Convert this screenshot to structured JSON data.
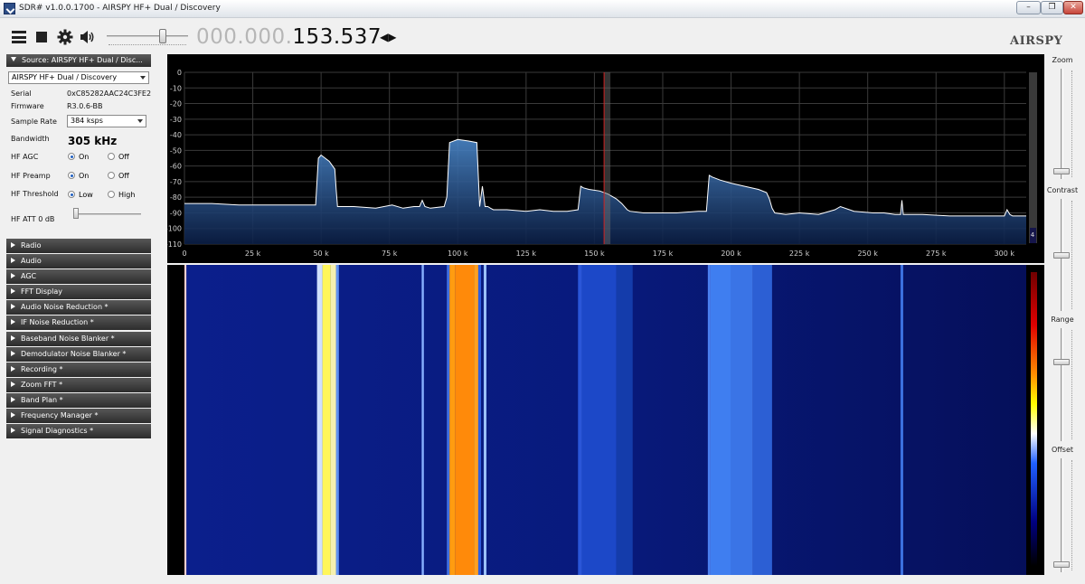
{
  "window": {
    "title": "SDR# v1.0.0.1700 - AIRSPY HF+ Dual / Discovery",
    "controls": {
      "minimize": "–",
      "maximize": "❐",
      "close": "✕"
    }
  },
  "toolbar": {
    "frequency_dim": "000.000.",
    "frequency_bright": "153.537",
    "tune_arrows": "◀▶",
    "logo": "AIRSPY",
    "icons": [
      "menu-icon",
      "stop-icon",
      "gear-icon",
      "speaker-icon"
    ]
  },
  "source": {
    "header": "Source: AIRSPY HF+ Dual / Disc...",
    "device": "AIRSPY HF+ Dual / Discovery",
    "serial_label": "Serial",
    "serial": "0xC85282AAC24C3FE2",
    "firmware_label": "Firmware",
    "firmware": "R3.0.6-BB",
    "sample_rate_label": "Sample Rate",
    "sample_rate": "384 ksps",
    "bandwidth_label": "Bandwidth",
    "bandwidth": "305 kHz",
    "hf_agc_label": "HF AGC",
    "hf_preamp_label": "HF Preamp",
    "hf_threshold_label": "HF Threshold",
    "on": "On",
    "off": "Off",
    "low": "Low",
    "high": "High",
    "hf_att_label": "HF ATT 0 dB",
    "hf_agc": "On",
    "hf_preamp": "On",
    "hf_threshold": "Low"
  },
  "plugins": [
    "Radio",
    "Audio",
    "AGC",
    "FFT Display",
    "Audio Noise Reduction *",
    "IF Noise Reduction *",
    "Baseband Noise Blanker *",
    "Demodulator Noise Blanker *",
    "Recording *",
    "Zoom FFT *",
    "Band Plan *",
    "Frequency Manager *",
    "Signal Diagnostics *"
  ],
  "right_panel": {
    "zoom": "Zoom",
    "contrast": "Contrast",
    "range": "Range",
    "offset": "Offset",
    "scroll_value": "4"
  },
  "colors": {
    "plot_bg": "#000000",
    "trace": "#ffffff",
    "fill": "#2a5b9a",
    "grid": "#3a3a3a",
    "cursor": "#d02020",
    "waterfall_bg": "#06126b"
  },
  "chart_data": {
    "type": "area",
    "title": "",
    "xlabel": "",
    "ylabel": "",
    "x_ticks": [
      "0",
      "25 k",
      "50 k",
      "75 k",
      "100 k",
      "125 k",
      "150 k",
      "175 k",
      "200 k",
      "225 k",
      "250 k",
      "275 k",
      "300 k"
    ],
    "y_ticks": [
      "0",
      "-10",
      "-20",
      "-30",
      "-40",
      "-50",
      "-60",
      "-70",
      "-80",
      "-90",
      "-100",
      "-110"
    ],
    "xlim": [
      0,
      308000
    ],
    "ylim": [
      -110,
      0
    ],
    "grid": true,
    "cursor_x": 153537,
    "series": [
      {
        "x": [
          0,
          10000,
          20000,
          30000,
          45000,
          48000,
          49000,
          50000,
          53000,
          55000,
          55500,
          56000,
          58000,
          62000,
          70000,
          76000,
          80000,
          84000,
          86000,
          87000,
          88000,
          90000,
          95000,
          96000,
          97000,
          100000,
          104000,
          107000,
          108000,
          109000,
          110000,
          111000,
          112000,
          113000,
          118000,
          125000,
          130000,
          135000,
          140000,
          144000,
          145000,
          146000,
          148000,
          152000,
          155000,
          158000,
          160000,
          162000,
          163000,
          168000,
          175000,
          180000,
          188000,
          191000,
          192000,
          193000,
          196000,
          200000,
          205000,
          210000,
          213000,
          214000,
          215000,
          216000,
          220000,
          225000,
          232000,
          238000,
          240000,
          245000,
          252000,
          256000,
          260000,
          262000,
          262500,
          263000,
          265000,
          270000,
          280000,
          290000,
          300000,
          301000,
          302000,
          303000,
          308000
        ],
        "y": [
          -84,
          -84,
          -85,
          -85,
          -85,
          -85,
          -55,
          -53,
          -57,
          -62,
          -75,
          -86,
          -86,
          -86,
          -87,
          -85,
          -87,
          -86,
          -86,
          -82,
          -86,
          -87,
          -86,
          -80,
          -45,
          -43,
          -44,
          -45,
          -86,
          -73,
          -86,
          -86,
          -87,
          -88,
          -88,
          -89,
          -88,
          -89,
          -89,
          -88,
          -73,
          -74,
          -75,
          -76,
          -78,
          -81,
          -84,
          -88,
          -89,
          -90,
          -90,
          -90,
          -89,
          -89,
          -66,
          -67,
          -69,
          -71,
          -73,
          -75,
          -77,
          -81,
          -87,
          -90,
          -91,
          -90,
          -91,
          -88,
          -86,
          -89,
          -90,
          -90,
          -91,
          -91,
          -82,
          -91,
          -91,
          -91,
          -92,
          -92,
          -92,
          -88,
          -91,
          -92,
          -92
        ]
      }
    ]
  }
}
